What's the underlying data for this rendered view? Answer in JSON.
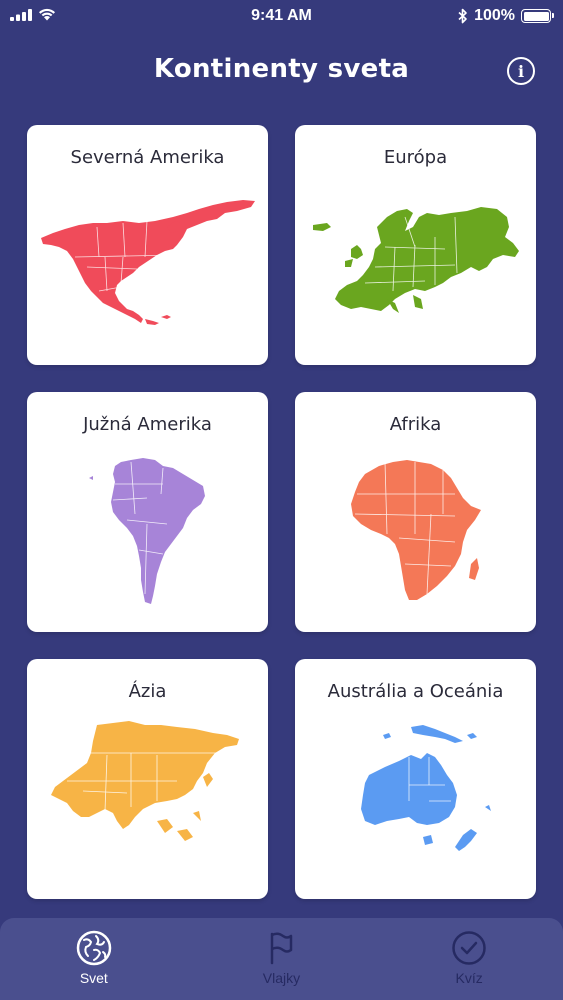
{
  "status": {
    "time": "9:41 AM",
    "battery": "100%",
    "icons": [
      "signal-icon",
      "wifi-icon",
      "bluetooth-icon",
      "battery-icon"
    ]
  },
  "header": {
    "title": "Kontinenty sveta",
    "info_icon": "info-icon"
  },
  "continents": [
    {
      "label": "Severná Amerika",
      "color": "#f04b5a"
    },
    {
      "label": "Európa",
      "color": "#6aa61f"
    },
    {
      "label": "Južná Amerika",
      "color": "#a784d8"
    },
    {
      "label": "Afrika",
      "color": "#f47857"
    },
    {
      "label": "Ázia",
      "color": "#f7b446"
    },
    {
      "label": "Austrália a Oceánia",
      "color": "#5b9bf2"
    }
  ],
  "tabs": [
    {
      "label": "Svet",
      "icon": "globe-icon",
      "active": true
    },
    {
      "label": "Vlajky",
      "icon": "flag-icon",
      "active": false
    },
    {
      "label": "Kvíz",
      "icon": "check-circle-icon",
      "active": false
    }
  ],
  "colors": {
    "background": "#363a7c",
    "tab_bar": "#4a4f8e",
    "tab_inactive": "#262a62"
  }
}
